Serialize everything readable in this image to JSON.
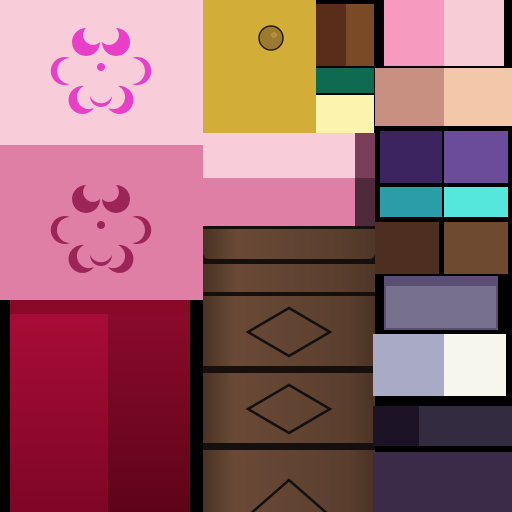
{
  "atlas": {
    "kind": "game texture atlas",
    "swatch_colors": {
      "pink_light": "#F8CCD8",
      "pink_mid": "#E07FA6",
      "magenta": "#E83EC8",
      "berry": "#9C2558",
      "crimson": "#9E0A2E",
      "crimson_dark": "#6E0620",
      "gold": "#D2AD38",
      "bronze_dot": "#9C7A30",
      "brown_dark": "#5A2C1A",
      "brown_mid": "#7A4A26",
      "green_dark": "#0E6A50",
      "cream": "#FCF3AE",
      "pink_swatch": "#F79AC0",
      "pink_pale": "#F7CCD6",
      "skin_dark": "#C89080",
      "skin_light": "#F3C8AA",
      "purple_dark": "#3C2460",
      "purple_mid": "#6A4C9A",
      "teal": "#2A9DA8",
      "aqua": "#55E6DC",
      "wood_dark": "#4E2E20",
      "wood_light": "#6E4A30",
      "lavender_grey": "#77708F",
      "grey_blue": "#A8AAC6",
      "offwhite": "#F7F6EC",
      "navy_dark": "#1C1426",
      "violet_dark": "#332B40",
      "plum_dark": "#3B2B48",
      "drawer_wood": "#5A3E2E",
      "drawer_edge": "#2A1C18"
    },
    "icons": [
      "flower-petals-icon",
      "diamond-emblem-icon",
      "round-knob-icon"
    ]
  }
}
